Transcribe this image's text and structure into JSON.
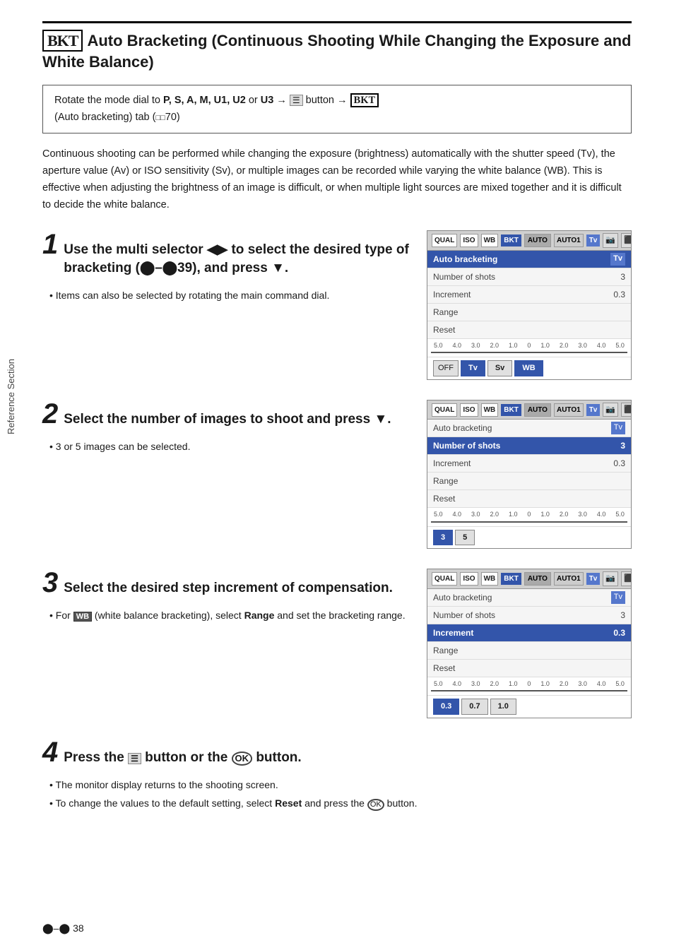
{
  "page": {
    "title_icon": "BKT",
    "title_text": "Auto Bracketing (Continuous Shooting While Changing the Exposure and White Balance)",
    "instruction_box": "Rotate the mode dial to P, S, A, M, U1, U2 or U3 → ☰ button → BKT (Auto bracketing) tab (□□70)",
    "intro": "Continuous shooting can be performed while changing the exposure (brightness) automatically with the shutter speed (Tv), the aperture value (Av) or ISO sensitivity (Sv), or multiple images can be recorded while varying the white balance (WB). This is effective when adjusting the brightness of an image is difficult, or when multiple light sources are mixed together and it is difficult to decide the white balance.",
    "sidebar_label": "Reference Section",
    "footer_page": "⬤–⬤38"
  },
  "steps": [
    {
      "number": "1",
      "title": "Use the multi selector ◀▶ to select the desired type of bracketing (⬤–⬤39), and press ▼.",
      "bullets": [
        "Items can also be selected by rotating the main command dial."
      ],
      "panel": {
        "topbar": [
          "QUAL",
          "ISO",
          "WB",
          "BKT",
          "Tv",
          "📷",
          "⬛"
        ],
        "rows": [
          {
            "label": "Auto bracketing",
            "value": "Tv",
            "highlight": true
          },
          {
            "label": "Number of shots",
            "value": "3",
            "highlight": false
          },
          {
            "label": "Increment",
            "value": "0.3",
            "highlight": false
          },
          {
            "label": "Range",
            "value": "",
            "highlight": false
          },
          {
            "label": "Reset",
            "value": "",
            "highlight": false
          }
        ],
        "scale_labels": [
          "5.0",
          "4.0",
          "3.0",
          "2.0",
          "1.0",
          "0",
          "1.0",
          "2.0",
          "3.0",
          "4.0",
          "5.0"
        ],
        "options": [
          "OFF",
          "Tv",
          "Sv",
          "WB"
        ],
        "options_selected": 1
      }
    },
    {
      "number": "2",
      "title": "Select the number of images to shoot and press ▼.",
      "bullets": [
        "3 or 5 images can be selected."
      ],
      "panel": {
        "topbar": [
          "QUAL",
          "ISO",
          "WB",
          "BKT",
          "Tv",
          "📷",
          "⬛"
        ],
        "rows": [
          {
            "label": "Auto bracketing",
            "value": "Tv",
            "highlight": false
          },
          {
            "label": "Number of shots",
            "value": "3",
            "highlight": true
          },
          {
            "label": "Increment",
            "value": "0.3",
            "highlight": false
          },
          {
            "label": "Range",
            "value": "",
            "highlight": false
          },
          {
            "label": "Reset",
            "value": "",
            "highlight": false
          }
        ],
        "scale_labels": [
          "5.0",
          "4.0",
          "3.0",
          "2.0",
          "1.0",
          "0",
          "1.0",
          "2.0",
          "3.0",
          "4.0",
          "5.0"
        ],
        "options": [
          "3",
          "5"
        ],
        "options_selected": 0
      }
    },
    {
      "number": "3",
      "title": "Select the desired step increment of compensation.",
      "bullets": [
        "For WB (white balance bracketing), select Range and set the bracketing range."
      ],
      "panel": {
        "topbar": [
          "QUAL",
          "ISO",
          "WB",
          "BKT",
          "Tv",
          "📷",
          "⬛"
        ],
        "rows": [
          {
            "label": "Auto bracketing",
            "value": "Tv",
            "highlight": false
          },
          {
            "label": "Number of shots",
            "value": "3",
            "highlight": false
          },
          {
            "label": "Increment",
            "value": "0.3",
            "highlight": true
          },
          {
            "label": "Range",
            "value": "",
            "highlight": false
          },
          {
            "label": "Reset",
            "value": "",
            "highlight": false
          }
        ],
        "scale_labels": [
          "5.0",
          "4.0",
          "3.0",
          "2.0",
          "1.0",
          "0",
          "1.0",
          "2.0",
          "3.0",
          "4.0",
          "5.0"
        ],
        "options": [
          "0.3",
          "0.7",
          "1.0"
        ],
        "options_selected": 0
      }
    }
  ],
  "step4": {
    "number": "4",
    "title": "Press the ☰ button or the ⊛ button.",
    "bullets": [
      "The monitor display returns to the shooting screen.",
      "To change the values to the default setting, select Reset and press the ⊛ button."
    ]
  },
  "labels": {
    "wb_note": "WB",
    "range_label": "Range",
    "reset_label": "Reset",
    "bold_range": "Range",
    "bold_reset": "Reset"
  }
}
